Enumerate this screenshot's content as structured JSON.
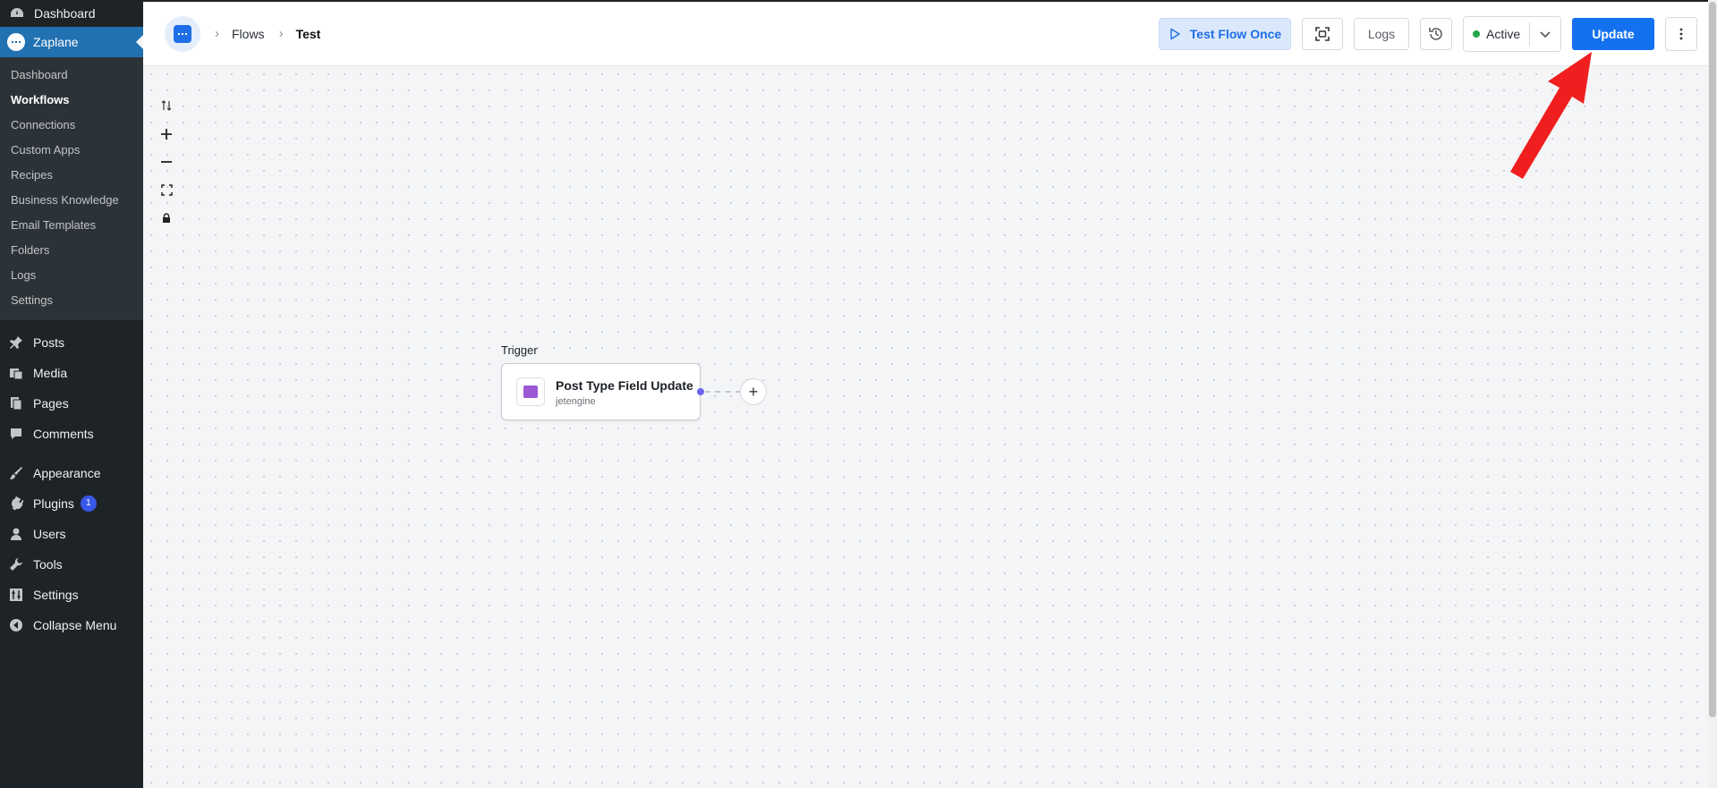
{
  "wp_sidebar": {
    "top_item": "Dashboard",
    "active_plugin": "Zaplane",
    "submenu": [
      "Dashboard",
      "Workflows",
      "Connections",
      "Custom Apps",
      "Recipes",
      "Business Knowledge",
      "Email Templates",
      "Folders",
      "Logs",
      "Settings"
    ],
    "current_submenu": "Workflows",
    "menu": {
      "posts": "Posts",
      "media": "Media",
      "pages": "Pages",
      "comments": "Comments",
      "appearance": "Appearance",
      "plugins": "Plugins",
      "plugins_badge": "1",
      "users": "Users",
      "tools": "Tools",
      "settings": "Settings",
      "collapse": "Collapse Menu"
    }
  },
  "topbar": {
    "breadcrumb_flows": "Flows",
    "breadcrumb_current": "Test",
    "test_flow_label": "Test Flow Once",
    "logs_label": "Logs",
    "status_label": "Active",
    "update_label": "Update"
  },
  "canvas": {
    "trigger_label": "Trigger",
    "node_title": "Post Type Field Update",
    "node_subtitle": "jetengine",
    "add_symbol": "+"
  },
  "colors": {
    "accent": "#1371f0",
    "sidebar_bg": "#1d2327",
    "active_dot": "#22a84a",
    "annotation_arrow": "#f01e1e"
  }
}
